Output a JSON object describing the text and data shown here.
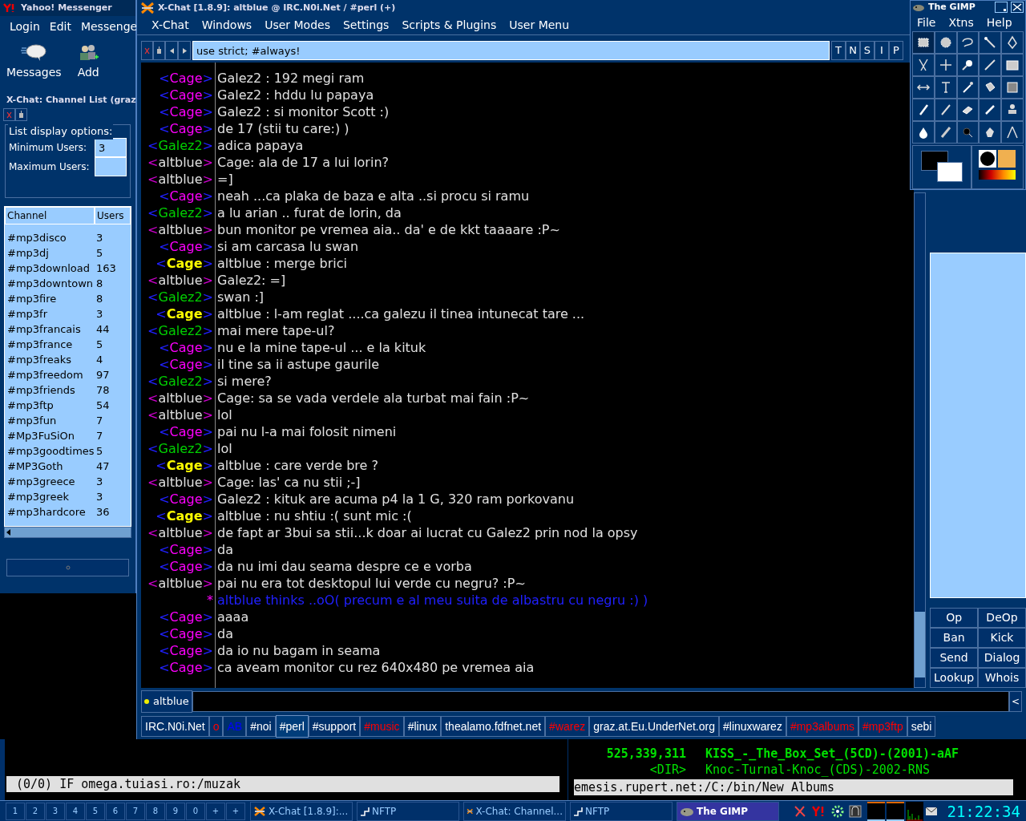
{
  "yahoo": {
    "title": "Yahoo! Messenger",
    "menu": [
      "Login",
      "Edit",
      "Messenge"
    ],
    "toolbar": [
      "Messages",
      "Add"
    ]
  },
  "channel_list": {
    "title": "X-Chat: Channel List (graz",
    "options_label": "List display options:",
    "min_label": "Minimum Users:",
    "min_value": "3",
    "max_label": "Maximum Users:",
    "columns": [
      "Channel",
      "Users"
    ],
    "rows": [
      {
        "channel": "#mp3disco",
        "users": "3"
      },
      {
        "channel": "#mp3dj",
        "users": "5"
      },
      {
        "channel": "#mp3download",
        "users": "163"
      },
      {
        "channel": "#mp3downtown",
        "users": "8"
      },
      {
        "channel": "#mp3fire",
        "users": "8"
      },
      {
        "channel": "#mp3fr",
        "users": "3"
      },
      {
        "channel": "#mp3francais",
        "users": "44"
      },
      {
        "channel": "#mp3france",
        "users": "5"
      },
      {
        "channel": "#mp3freaks",
        "users": "4"
      },
      {
        "channel": "#mp3freedom",
        "users": "97"
      },
      {
        "channel": "#mp3friends",
        "users": "78"
      },
      {
        "channel": "#mp3ftp",
        "users": "54"
      },
      {
        "channel": "#mp3fun",
        "users": "7"
      },
      {
        "channel": "#Mp3FuSiOn",
        "users": "7"
      },
      {
        "channel": "#mp3goodtimes",
        "users": "5"
      },
      {
        "channel": "#MP3Goth",
        "users": "47"
      },
      {
        "channel": "#mp3greece",
        "users": "3"
      },
      {
        "channel": "#mp3greek",
        "users": "3"
      },
      {
        "channel": "#mp3hardcore",
        "users": "36"
      }
    ]
  },
  "xchat": {
    "title": "X-Chat [1.8.9]: altblue @ IRC.N0i.Net / #perl (+)",
    "menu": [
      "X-Chat",
      "Windows",
      "User Modes",
      "Settings",
      "Scripts & Plugins",
      "User Menu"
    ],
    "topic": "use strict; #always!",
    "modes": [
      "T",
      "N",
      "S",
      "I",
      "P"
    ],
    "messages": [
      {
        "kind": "message",
        "nick": "<Cage>",
        "color": "#ff00ff",
        "text": "Galez2 : 192 megi ram"
      },
      {
        "kind": "message",
        "nick": "<Cage>",
        "color": "#ff00ff",
        "text": "Galez2 : hddu lu papaya"
      },
      {
        "kind": "message",
        "nick": "<Cage>",
        "color": "#ff00ff",
        "text": "Galez2 : si monitor Scott :)"
      },
      {
        "kind": "message",
        "nick": "<Cage>",
        "color": "#ff00ff",
        "text": "de 17 (stii tu care:) )"
      },
      {
        "kind": "message",
        "nick": "<Galez2>",
        "color": "#00d000",
        "text": "adica papaya"
      },
      {
        "kind": "own",
        "nick": "<altblue>",
        "text": "Cage: ala de 17 a lui lorin?"
      },
      {
        "kind": "own",
        "nick": "<altblue>",
        "text": "=]"
      },
      {
        "kind": "message",
        "nick": "<Cage>",
        "color": "#ff00ff",
        "text": "neah ...ca plaka de baza e alta ..si procu si ramu"
      },
      {
        "kind": "message",
        "nick": "<Galez2>",
        "color": "#00d000",
        "text": "a lu arian .. furat de lorin, da"
      },
      {
        "kind": "own",
        "nick": "<altblue>",
        "text": "bun monitor pe vremea aia.. da' e de kkt taaaare :P~"
      },
      {
        "kind": "message",
        "nick": "<Cage>",
        "color": "#ff00ff",
        "text": "si am carcasa lu swan"
      },
      {
        "kind": "message",
        "nick": "<Cage>",
        "color": "#ffff00",
        "text": "altblue : merge brici"
      },
      {
        "kind": "own",
        "nick": "<altblue>",
        "text": "Galez2: =]"
      },
      {
        "kind": "message",
        "nick": "<Galez2>",
        "color": "#00d000",
        "text": "swan :]"
      },
      {
        "kind": "message",
        "nick": "<Cage>",
        "color": "#ffff00",
        "text": "altblue : l-am reglat ....ca galezu il tinea intunecat tare ..."
      },
      {
        "kind": "message",
        "nick": "<Galez2>",
        "color": "#00d000",
        "text": "mai mere tape-ul?"
      },
      {
        "kind": "message",
        "nick": "<Cage>",
        "color": "#ff00ff",
        "text": "nu e la mine tape-ul ... e la kituk"
      },
      {
        "kind": "message",
        "nick": "<Cage>",
        "color": "#ff00ff",
        "text": "il tine sa ii astupe gaurile"
      },
      {
        "kind": "message",
        "nick": "<Galez2>",
        "color": "#00d000",
        "text": "si mere?"
      },
      {
        "kind": "own",
        "nick": "<altblue>",
        "text": "Cage: sa se vada verdele ala turbat mai fain :P~"
      },
      {
        "kind": "own",
        "nick": "<altblue>",
        "text": "lol"
      },
      {
        "kind": "message",
        "nick": "<Cage>",
        "color": "#ff00ff",
        "text": "pai nu l-a mai folosit nimeni"
      },
      {
        "kind": "message",
        "nick": "<Galez2>",
        "color": "#00d000",
        "text": "lol"
      },
      {
        "kind": "message",
        "nick": "<Cage>",
        "color": "#ffff00",
        "text": "altblue : care verde bre ?"
      },
      {
        "kind": "own",
        "nick": "<altblue>",
        "text": "Cage: las' ca nu stii ;-]"
      },
      {
        "kind": "message",
        "nick": "<Cage>",
        "color": "#ff00ff",
        "text": "Galez2 : kituk are acuma p4 la 1 G, 320 ram porkovanu"
      },
      {
        "kind": "message",
        "nick": "<Cage>",
        "color": "#ffff00",
        "text": "altblue : nu shtiu :( sunt mic :("
      },
      {
        "kind": "own",
        "nick": "<altblue>",
        "text": "de fapt ar 3bui sa stii...k doar ai lucrat cu Galez2 prin nod la opsy"
      },
      {
        "kind": "message",
        "nick": "<Cage>",
        "color": "#ff00ff",
        "text": "da"
      },
      {
        "kind": "message",
        "nick": "<Cage>",
        "color": "#ff00ff",
        "text": "da nu imi dau seama despre ce e vorba"
      },
      {
        "kind": "own",
        "nick": "<altblue>",
        "text": "pai nu era tot desktopul lui verde cu negru? :P~"
      },
      {
        "kind": "action",
        "nick": "*",
        "text": "altblue thinks ..oO( precum e al meu suita de albastru cu negru :) )"
      },
      {
        "kind": "message",
        "nick": "<Cage>",
        "color": "#ff00ff",
        "text": "aaaa"
      },
      {
        "kind": "message",
        "nick": "<Cage>",
        "color": "#ff00ff",
        "text": "da"
      },
      {
        "kind": "message",
        "nick": "<Cage>",
        "color": "#ff00ff",
        "text": "da io nu bagam in seama"
      },
      {
        "kind": "message",
        "nick": "<Cage>",
        "color": "#ff00ff",
        "text": "ca aveam monitor cu rez 640x480 pe vremea aia"
      }
    ],
    "user_buttons": [
      "Op",
      "DeOp",
      "Ban",
      "Kick",
      "Send",
      "Dialog",
      "Lookup",
      "Whois"
    ],
    "nick": "altblue",
    "collapse": "<",
    "tabs": [
      {
        "label": "IRC.N0i.Net",
        "selected": false,
        "color": "#ffffff"
      },
      {
        "label": "o",
        "selected": false,
        "color": "#ff0000"
      },
      {
        "label": "AB",
        "selected": false,
        "color": "#0000ff"
      },
      {
        "label": "#noi",
        "selected": false,
        "color": "#ffffff"
      },
      {
        "label": "#perl",
        "selected": true,
        "color": "#ffffff"
      },
      {
        "label": "#support",
        "selected": false,
        "color": "#ffffff"
      },
      {
        "label": "#music",
        "selected": false,
        "color": "#ff0000"
      },
      {
        "label": "#linux",
        "selected": false,
        "color": "#ffffff"
      },
      {
        "label": "thealamo.fdfnet.net",
        "selected": false,
        "color": "#ffffff"
      },
      {
        "label": "#warez",
        "selected": false,
        "color": "#ff0000"
      },
      {
        "label": "graz.at.Eu.UnderNet.org",
        "selected": false,
        "color": "#ffffff"
      },
      {
        "label": "#linuxwarez",
        "selected": false,
        "color": "#ffffff"
      },
      {
        "label": "#mp3albums",
        "selected": false,
        "color": "#ff0000"
      },
      {
        "label": "#mp3ftp",
        "selected": false,
        "color": "#ff0000"
      },
      {
        "label": "sebi",
        "selected": false,
        "color": "#ffffff"
      }
    ]
  },
  "gimp": {
    "title": "The GIMP",
    "menu": [
      "File",
      "Xtns",
      "Help"
    ]
  },
  "terminal": {
    "status": "(0/0) IF omega.tuiasi.ro:/muzak"
  },
  "nftp": {
    "lines": [
      {
        "size": "525,339,311",
        "name": "KISS_-_The_Box_Set_(5CD)-(2001)-aAF",
        "bold": true
      },
      {
        "size": "<DIR>",
        "name": "Knoc-Turnal-Knoc_(CDS)-2002-RNS",
        "bold": false
      }
    ],
    "status": "emesis.rupert.net:/C:/bin/New Albums"
  },
  "taskbar": {
    "desktops": [
      "1",
      "2",
      "3",
      "4",
      "5",
      "6",
      "7",
      "8",
      "9",
      "0",
      "+",
      "+"
    ],
    "tasks": [
      {
        "label": "X-Chat [1.8.9]:...",
        "kind": "xchat",
        "selected": false
      },
      {
        "label": "NFTP",
        "kind": "nftp",
        "selected": false
      },
      {
        "label": "X-Chat: Channel...",
        "kind": "xchat",
        "selected": false
      },
      {
        "label": "NFTP",
        "kind": "nftp",
        "selected": false
      },
      {
        "label": "The GIMP",
        "kind": "gimp",
        "selected": true
      }
    ],
    "clock": "21:22:34"
  }
}
